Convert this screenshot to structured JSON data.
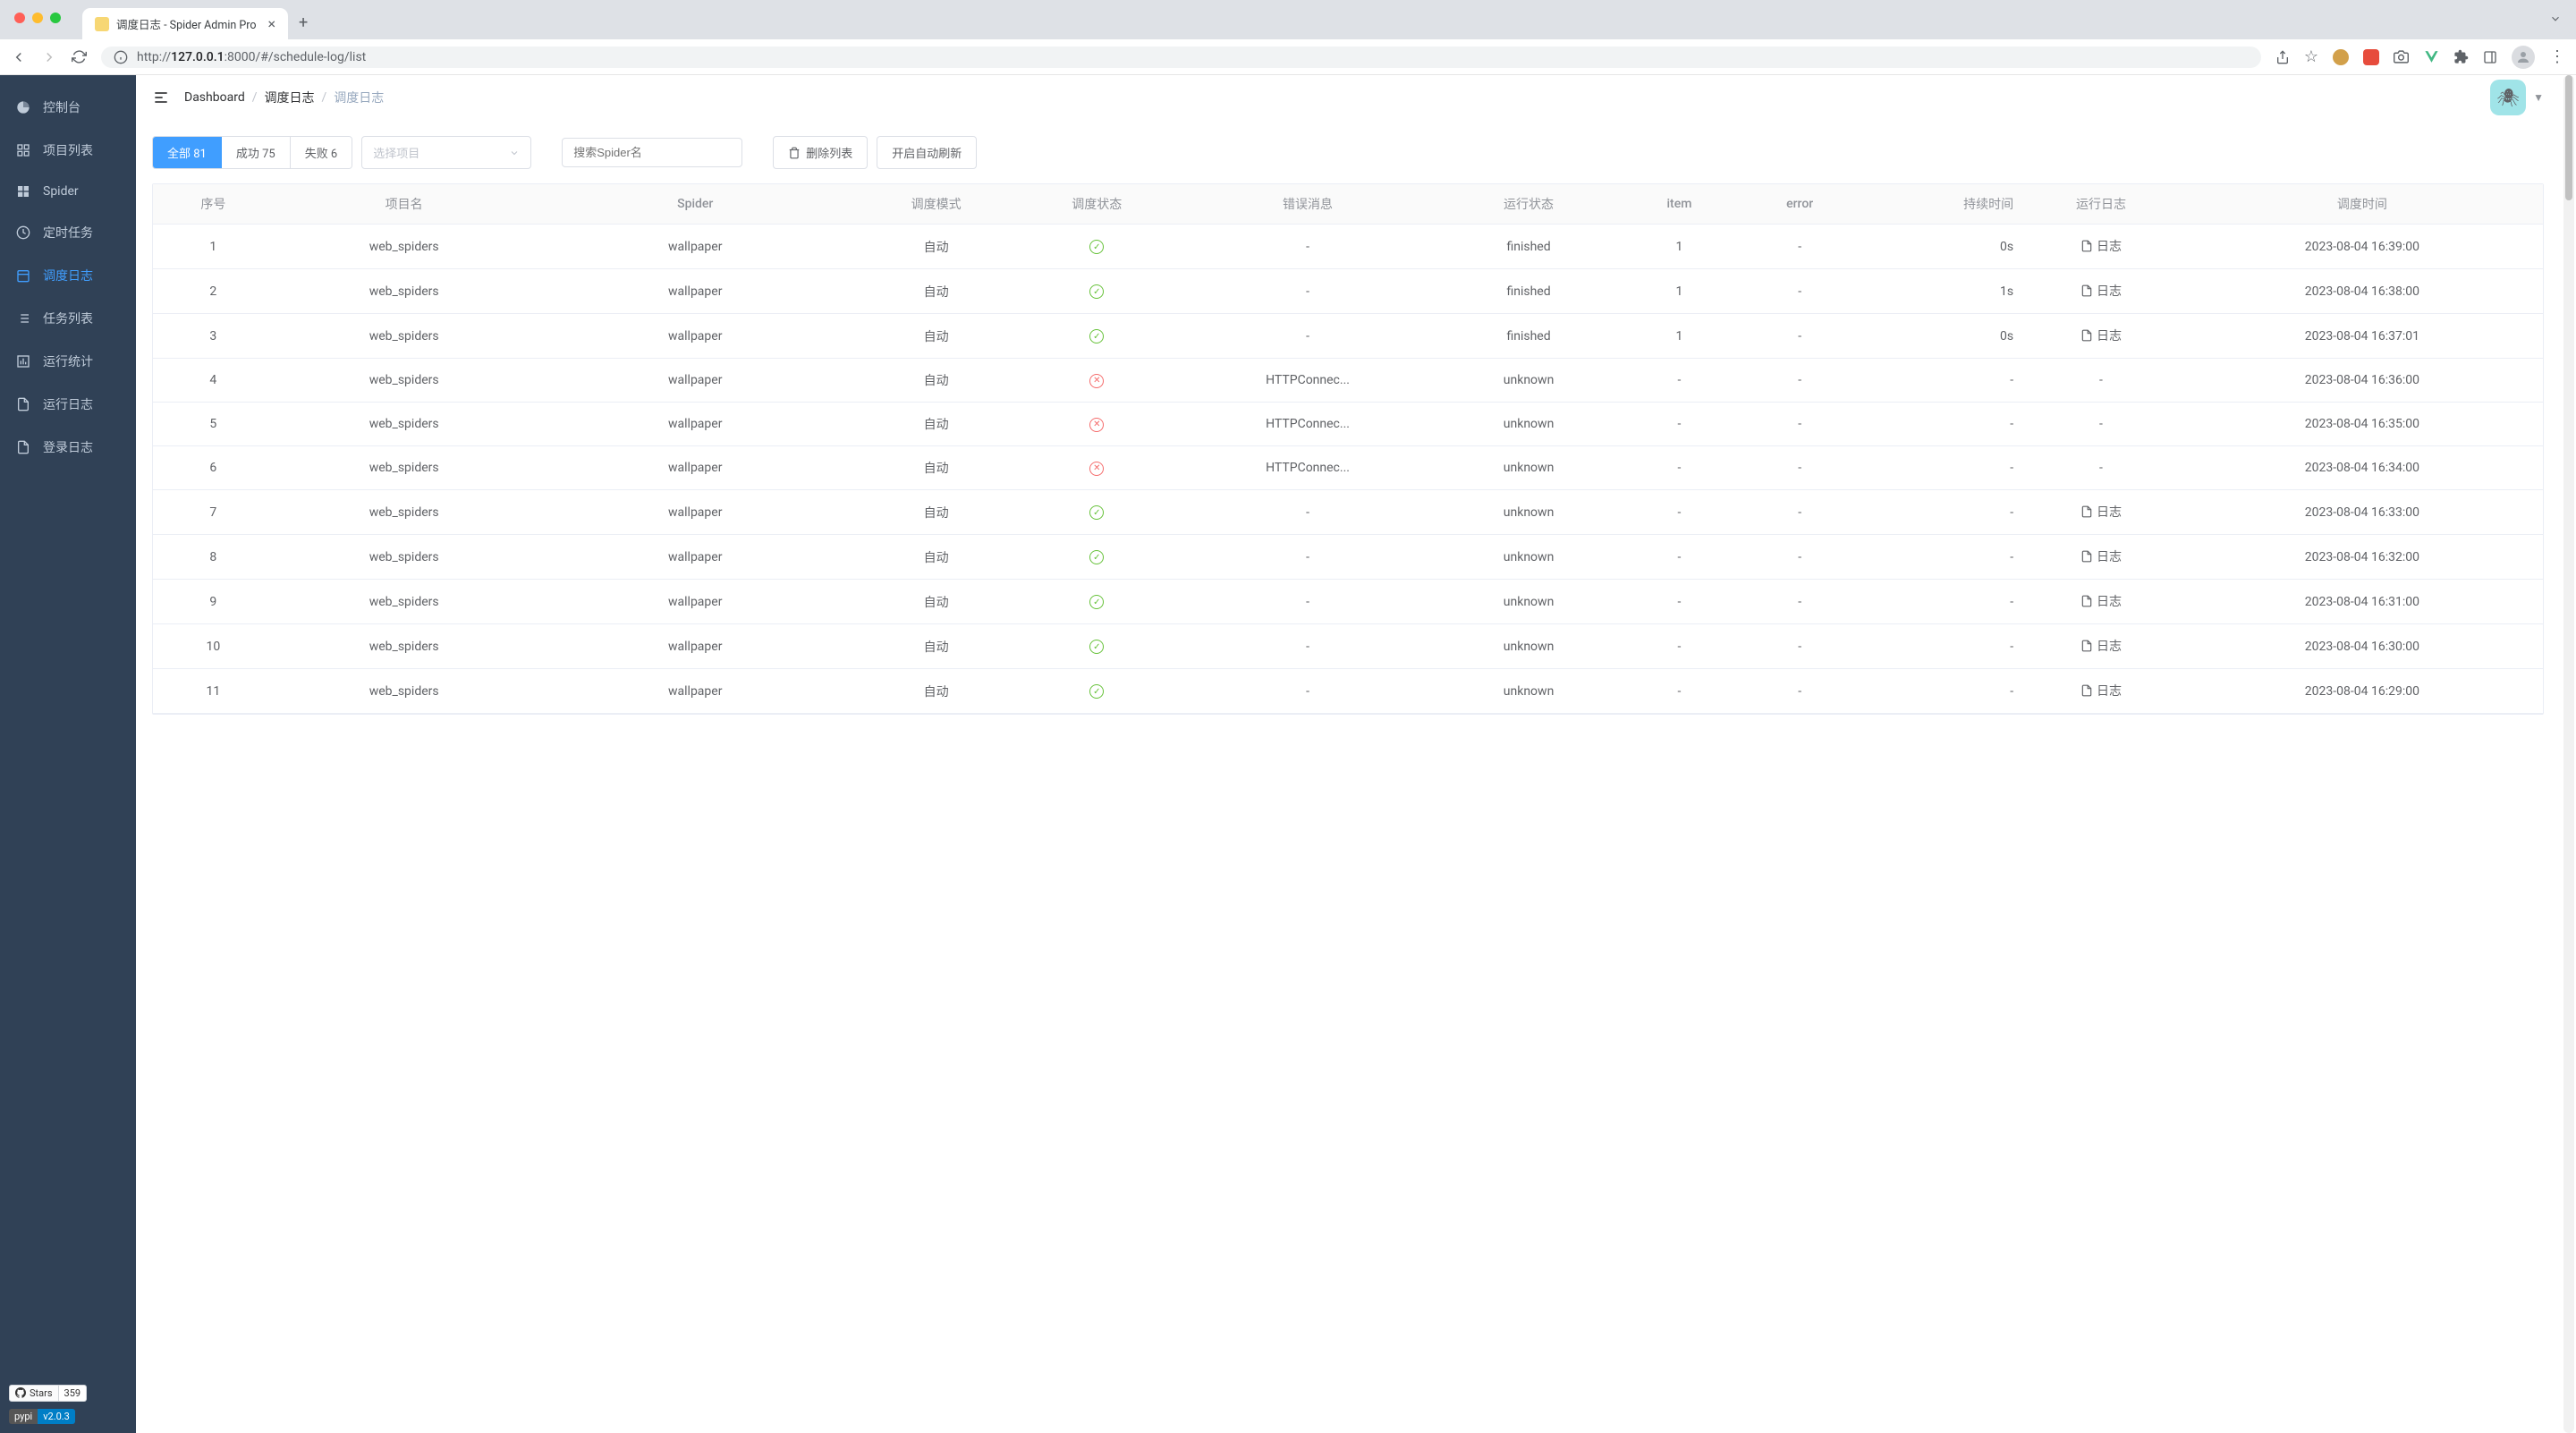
{
  "browser": {
    "tab_title": "调度日志 - Spider Admin Pro",
    "url_host": "127.0.0.1",
    "url_port": ":8000",
    "url_path": "/#/schedule-log/list",
    "url_prefix": "http://"
  },
  "sidebar": {
    "items": [
      {
        "icon": "dashboard",
        "label": "控制台"
      },
      {
        "icon": "grid",
        "label": "项目列表"
      },
      {
        "icon": "apps",
        "label": "Spider"
      },
      {
        "icon": "clock",
        "label": "定时任务"
      },
      {
        "icon": "calendar",
        "label": "调度日志",
        "active": true
      },
      {
        "icon": "list",
        "label": "任务列表"
      },
      {
        "icon": "chart",
        "label": "运行统计"
      },
      {
        "icon": "doc",
        "label": "运行日志"
      },
      {
        "icon": "doc",
        "label": "登录日志"
      }
    ],
    "github": {
      "stars_label": "Stars",
      "stars_count": "359"
    },
    "pypi": {
      "label": "pypi",
      "version": "v2.0.3"
    }
  },
  "breadcrumb": {
    "items": [
      "Dashboard",
      "调度日志",
      "调度日志"
    ]
  },
  "filters": {
    "all_label": "全部 81",
    "success_label": "成功 75",
    "fail_label": "失败 6",
    "select_placeholder": "选择项目",
    "search_placeholder": "搜索Spider名",
    "delete_button": "删除列表",
    "refresh_button": "开启自动刷新"
  },
  "table": {
    "headers": {
      "seq": "序号",
      "project": "项目名",
      "spider": "Spider",
      "mode": "调度模式",
      "status": "调度状态",
      "err_msg": "错误消息",
      "run_status": "运行状态",
      "item": "item",
      "error": "error",
      "duration": "持续时间",
      "run_log": "运行日志",
      "time": "调度时间"
    },
    "log_label": "日志",
    "mode_auto": "自动",
    "rows": [
      {
        "seq": "1",
        "project": "web_spiders",
        "spider": "wallpaper",
        "status_ok": true,
        "err": "-",
        "run": "finished",
        "item": "1",
        "error": "-",
        "dur": "0s",
        "has_log": true,
        "time": "2023-08-04 16:39:00"
      },
      {
        "seq": "2",
        "project": "web_spiders",
        "spider": "wallpaper",
        "status_ok": true,
        "err": "-",
        "run": "finished",
        "item": "1",
        "error": "-",
        "dur": "1s",
        "has_log": true,
        "time": "2023-08-04 16:38:00"
      },
      {
        "seq": "3",
        "project": "web_spiders",
        "spider": "wallpaper",
        "status_ok": true,
        "err": "-",
        "run": "finished",
        "item": "1",
        "error": "-",
        "dur": "0s",
        "has_log": true,
        "time": "2023-08-04 16:37:01"
      },
      {
        "seq": "4",
        "project": "web_spiders",
        "spider": "wallpaper",
        "status_ok": false,
        "err": "HTTPConnec...",
        "run": "unknown",
        "item": "-",
        "error": "-",
        "dur": "-",
        "has_log": false,
        "time": "2023-08-04 16:36:00"
      },
      {
        "seq": "5",
        "project": "web_spiders",
        "spider": "wallpaper",
        "status_ok": false,
        "err": "HTTPConnec...",
        "run": "unknown",
        "item": "-",
        "error": "-",
        "dur": "-",
        "has_log": false,
        "time": "2023-08-04 16:35:00"
      },
      {
        "seq": "6",
        "project": "web_spiders",
        "spider": "wallpaper",
        "status_ok": false,
        "err": "HTTPConnec...",
        "run": "unknown",
        "item": "-",
        "error": "-",
        "dur": "-",
        "has_log": false,
        "time": "2023-08-04 16:34:00"
      },
      {
        "seq": "7",
        "project": "web_spiders",
        "spider": "wallpaper",
        "status_ok": true,
        "err": "-",
        "run": "unknown",
        "item": "-",
        "error": "-",
        "dur": "-",
        "has_log": true,
        "time": "2023-08-04 16:33:00"
      },
      {
        "seq": "8",
        "project": "web_spiders",
        "spider": "wallpaper",
        "status_ok": true,
        "err": "-",
        "run": "unknown",
        "item": "-",
        "error": "-",
        "dur": "-",
        "has_log": true,
        "time": "2023-08-04 16:32:00"
      },
      {
        "seq": "9",
        "project": "web_spiders",
        "spider": "wallpaper",
        "status_ok": true,
        "err": "-",
        "run": "unknown",
        "item": "-",
        "error": "-",
        "dur": "-",
        "has_log": true,
        "time": "2023-08-04 16:31:00"
      },
      {
        "seq": "10",
        "project": "web_spiders",
        "spider": "wallpaper",
        "status_ok": true,
        "err": "-",
        "run": "unknown",
        "item": "-",
        "error": "-",
        "dur": "-",
        "has_log": true,
        "time": "2023-08-04 16:30:00"
      },
      {
        "seq": "11",
        "project": "web_spiders",
        "spider": "wallpaper",
        "status_ok": true,
        "err": "-",
        "run": "unknown",
        "item": "-",
        "error": "-",
        "dur": "-",
        "has_log": true,
        "time": "2023-08-04 16:29:00"
      }
    ]
  }
}
